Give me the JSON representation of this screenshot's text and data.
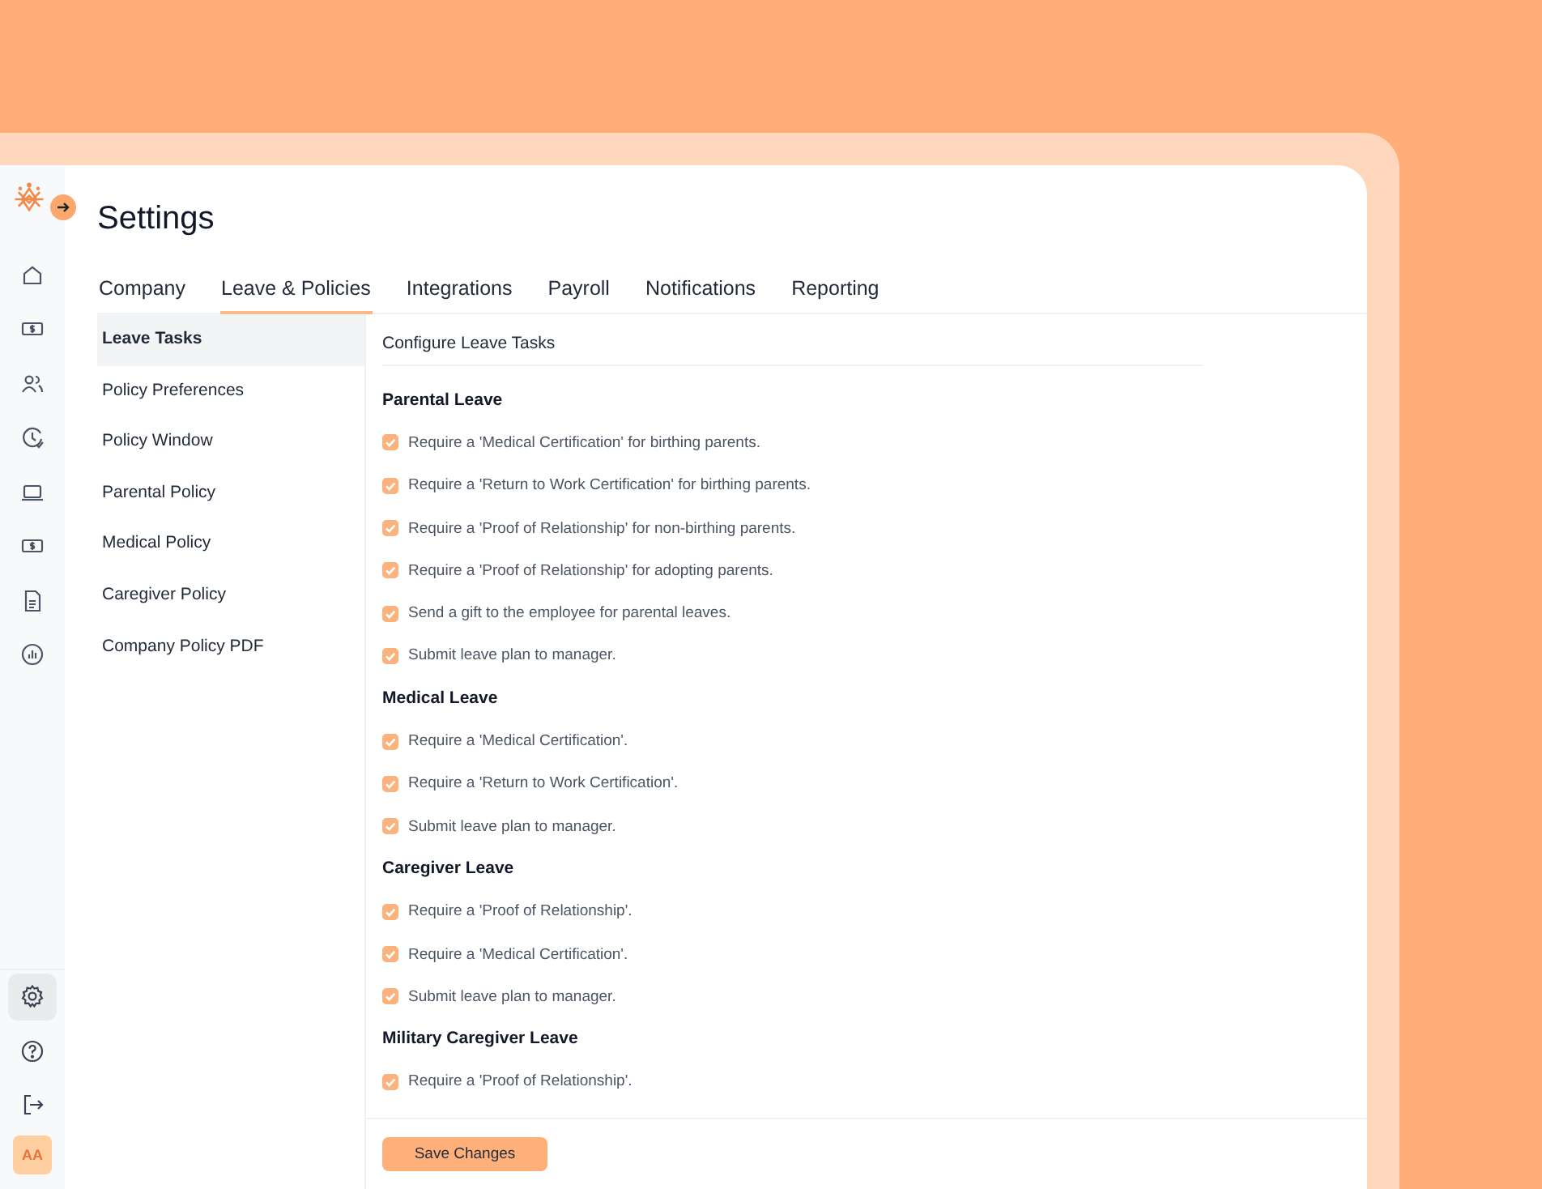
{
  "sidebar": {
    "top_items": [
      {
        "selected": false
      },
      {
        "selected": false
      },
      {
        "selected": false
      },
      {
        "selected": false
      },
      {
        "selected": false
      },
      {
        "selected": false
      },
      {
        "selected": false
      },
      {
        "selected": false
      }
    ],
    "bottom_items": [
      {
        "selected": true
      },
      {
        "selected": false
      },
      {
        "selected": false
      }
    ],
    "avatar": "AA"
  },
  "title": "Settings",
  "tabs": [
    {
      "label": "Company",
      "selected": false
    },
    {
      "label": "Leave & Policies",
      "selected": true
    },
    {
      "label": "Integrations",
      "selected": false
    },
    {
      "label": "Payroll",
      "selected": false
    },
    {
      "label": "Notifications",
      "selected": false
    },
    {
      "label": "Reporting",
      "selected": false
    }
  ],
  "submenu": [
    {
      "label": "Leave Tasks",
      "selected": true
    },
    {
      "label": "Policy Preferences",
      "selected": false
    },
    {
      "label": "Policy Window",
      "selected": false
    },
    {
      "label": "Parental Policy",
      "selected": false
    },
    {
      "label": "Medical Policy",
      "selected": false
    },
    {
      "label": "Caregiver Policy",
      "selected": false
    },
    {
      "label": "Company Policy PDF",
      "selected": false
    }
  ],
  "panel_title": "Configure Leave Tasks",
  "sections": [
    {
      "heading": "Parental Leave",
      "tasks": [
        {
          "label": "Require a 'Medical Certification' for birthing parents.",
          "checked": true
        },
        {
          "label": "Require a 'Return to Work Certification' for birthing parents.",
          "checked": true
        },
        {
          "label": "Require a 'Proof of Relationship' for non-birthing parents.",
          "checked": true
        },
        {
          "label": "Require a 'Proof of Relationship' for adopting parents.",
          "checked": true
        },
        {
          "label": "Send a gift to the employee for parental leaves.",
          "checked": true
        },
        {
          "label": "Submit leave plan to manager.",
          "checked": true
        }
      ]
    },
    {
      "heading": "Medical Leave",
      "tasks": [
        {
          "label": "Require a 'Medical Certification'.",
          "checked": true
        },
        {
          "label": "Require a 'Return to Work Certification'.",
          "checked": true
        },
        {
          "label": "Submit leave plan to manager.",
          "checked": true
        }
      ]
    },
    {
      "heading": "Caregiver Leave",
      "tasks": [
        {
          "label": "Require a 'Proof of Relationship'.",
          "checked": true
        },
        {
          "label": "Require a 'Medical Certification'.",
          "checked": true
        },
        {
          "label": "Submit leave plan to manager.",
          "checked": true
        }
      ]
    },
    {
      "heading": "Military Caregiver Leave",
      "tasks": [
        {
          "label": "Require a 'Proof of Relationship'.",
          "checked": true
        }
      ]
    }
  ],
  "save_button": "Save Changes"
}
